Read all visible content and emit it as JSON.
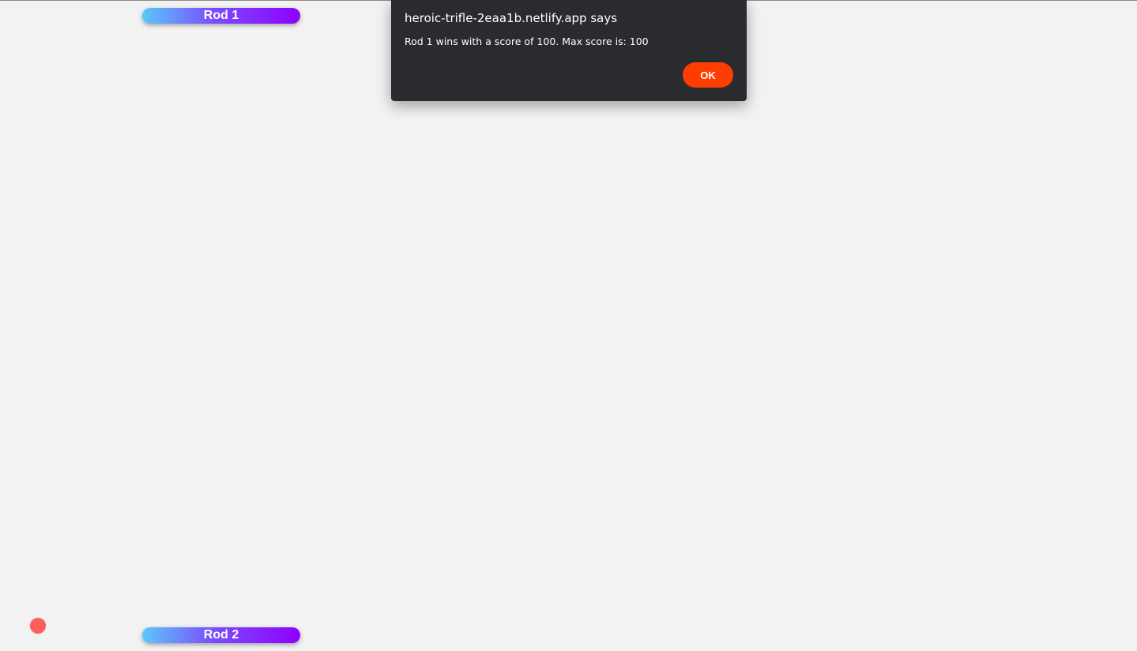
{
  "game": {
    "rod_top_label": "Rod 1",
    "rod_bottom_label": "Rod 2",
    "colors": {
      "background": "#f2f2f2",
      "rod_gradient_start": "#5ac8fa",
      "rod_gradient_end": "#8f00ff",
      "ball": "#ff5c5c"
    }
  },
  "alert": {
    "title": "heroic-trifle-2eaa1b.netlify.app says",
    "message": "Rod 1 wins with a score of 100. Max score is: 100",
    "ok_label": "OK",
    "colors": {
      "background": "#2a2b2f",
      "button": "#ff3d00"
    }
  }
}
